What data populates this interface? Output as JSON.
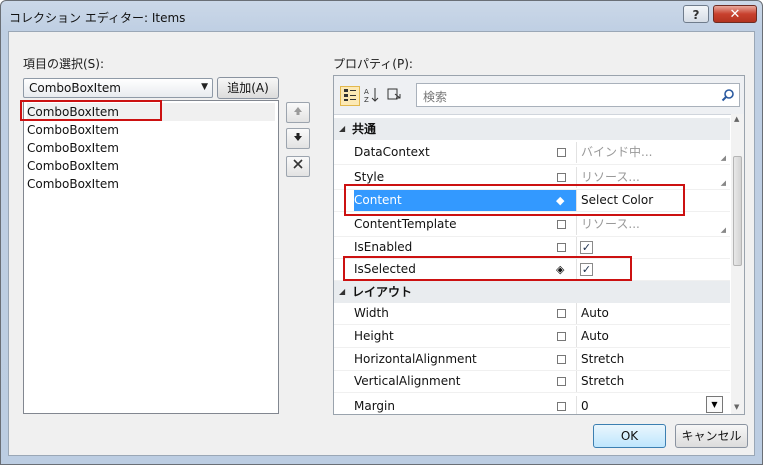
{
  "window": {
    "title": "コレクション エディター: Items"
  },
  "left": {
    "label": "項目の選択(S):",
    "combo_value": "ComboBoxItem",
    "add_button": "追加(A)",
    "items": [
      "ComboBoxItem",
      "ComboBoxItem",
      "ComboBoxItem",
      "ComboBoxItem",
      "ComboBoxItem"
    ]
  },
  "right": {
    "label": "プロパティ(P):",
    "search_placeholder": "検索",
    "categories": [
      "共通",
      "レイアウト"
    ],
    "rows": [
      {
        "name": "DataContext",
        "value": "バインド中..."
      },
      {
        "name": "Style",
        "value": "リソース..."
      },
      {
        "name": "Content",
        "value": "Select Color"
      },
      {
        "name": "ContentTemplate",
        "value": "リソース..."
      },
      {
        "name": "IsEnabled",
        "value": "✓"
      },
      {
        "name": "IsSelected",
        "value": "✓"
      },
      {
        "name": "Width",
        "value": "Auto"
      },
      {
        "name": "Height",
        "value": "Auto"
      },
      {
        "name": "HorizontalAlignment",
        "value": "Stretch"
      },
      {
        "name": "VerticalAlignment",
        "value": "Stretch"
      },
      {
        "name": "Margin",
        "value": "0"
      }
    ]
  },
  "buttons": {
    "ok": "OK",
    "cancel": "キャンセル"
  },
  "icons": {
    "help": "?",
    "close": "✕",
    "up": "🡅",
    "down": "🡇",
    "remove": "✕"
  },
  "colors": {
    "selection": "#3399ff",
    "annotation": "#cc1111"
  }
}
